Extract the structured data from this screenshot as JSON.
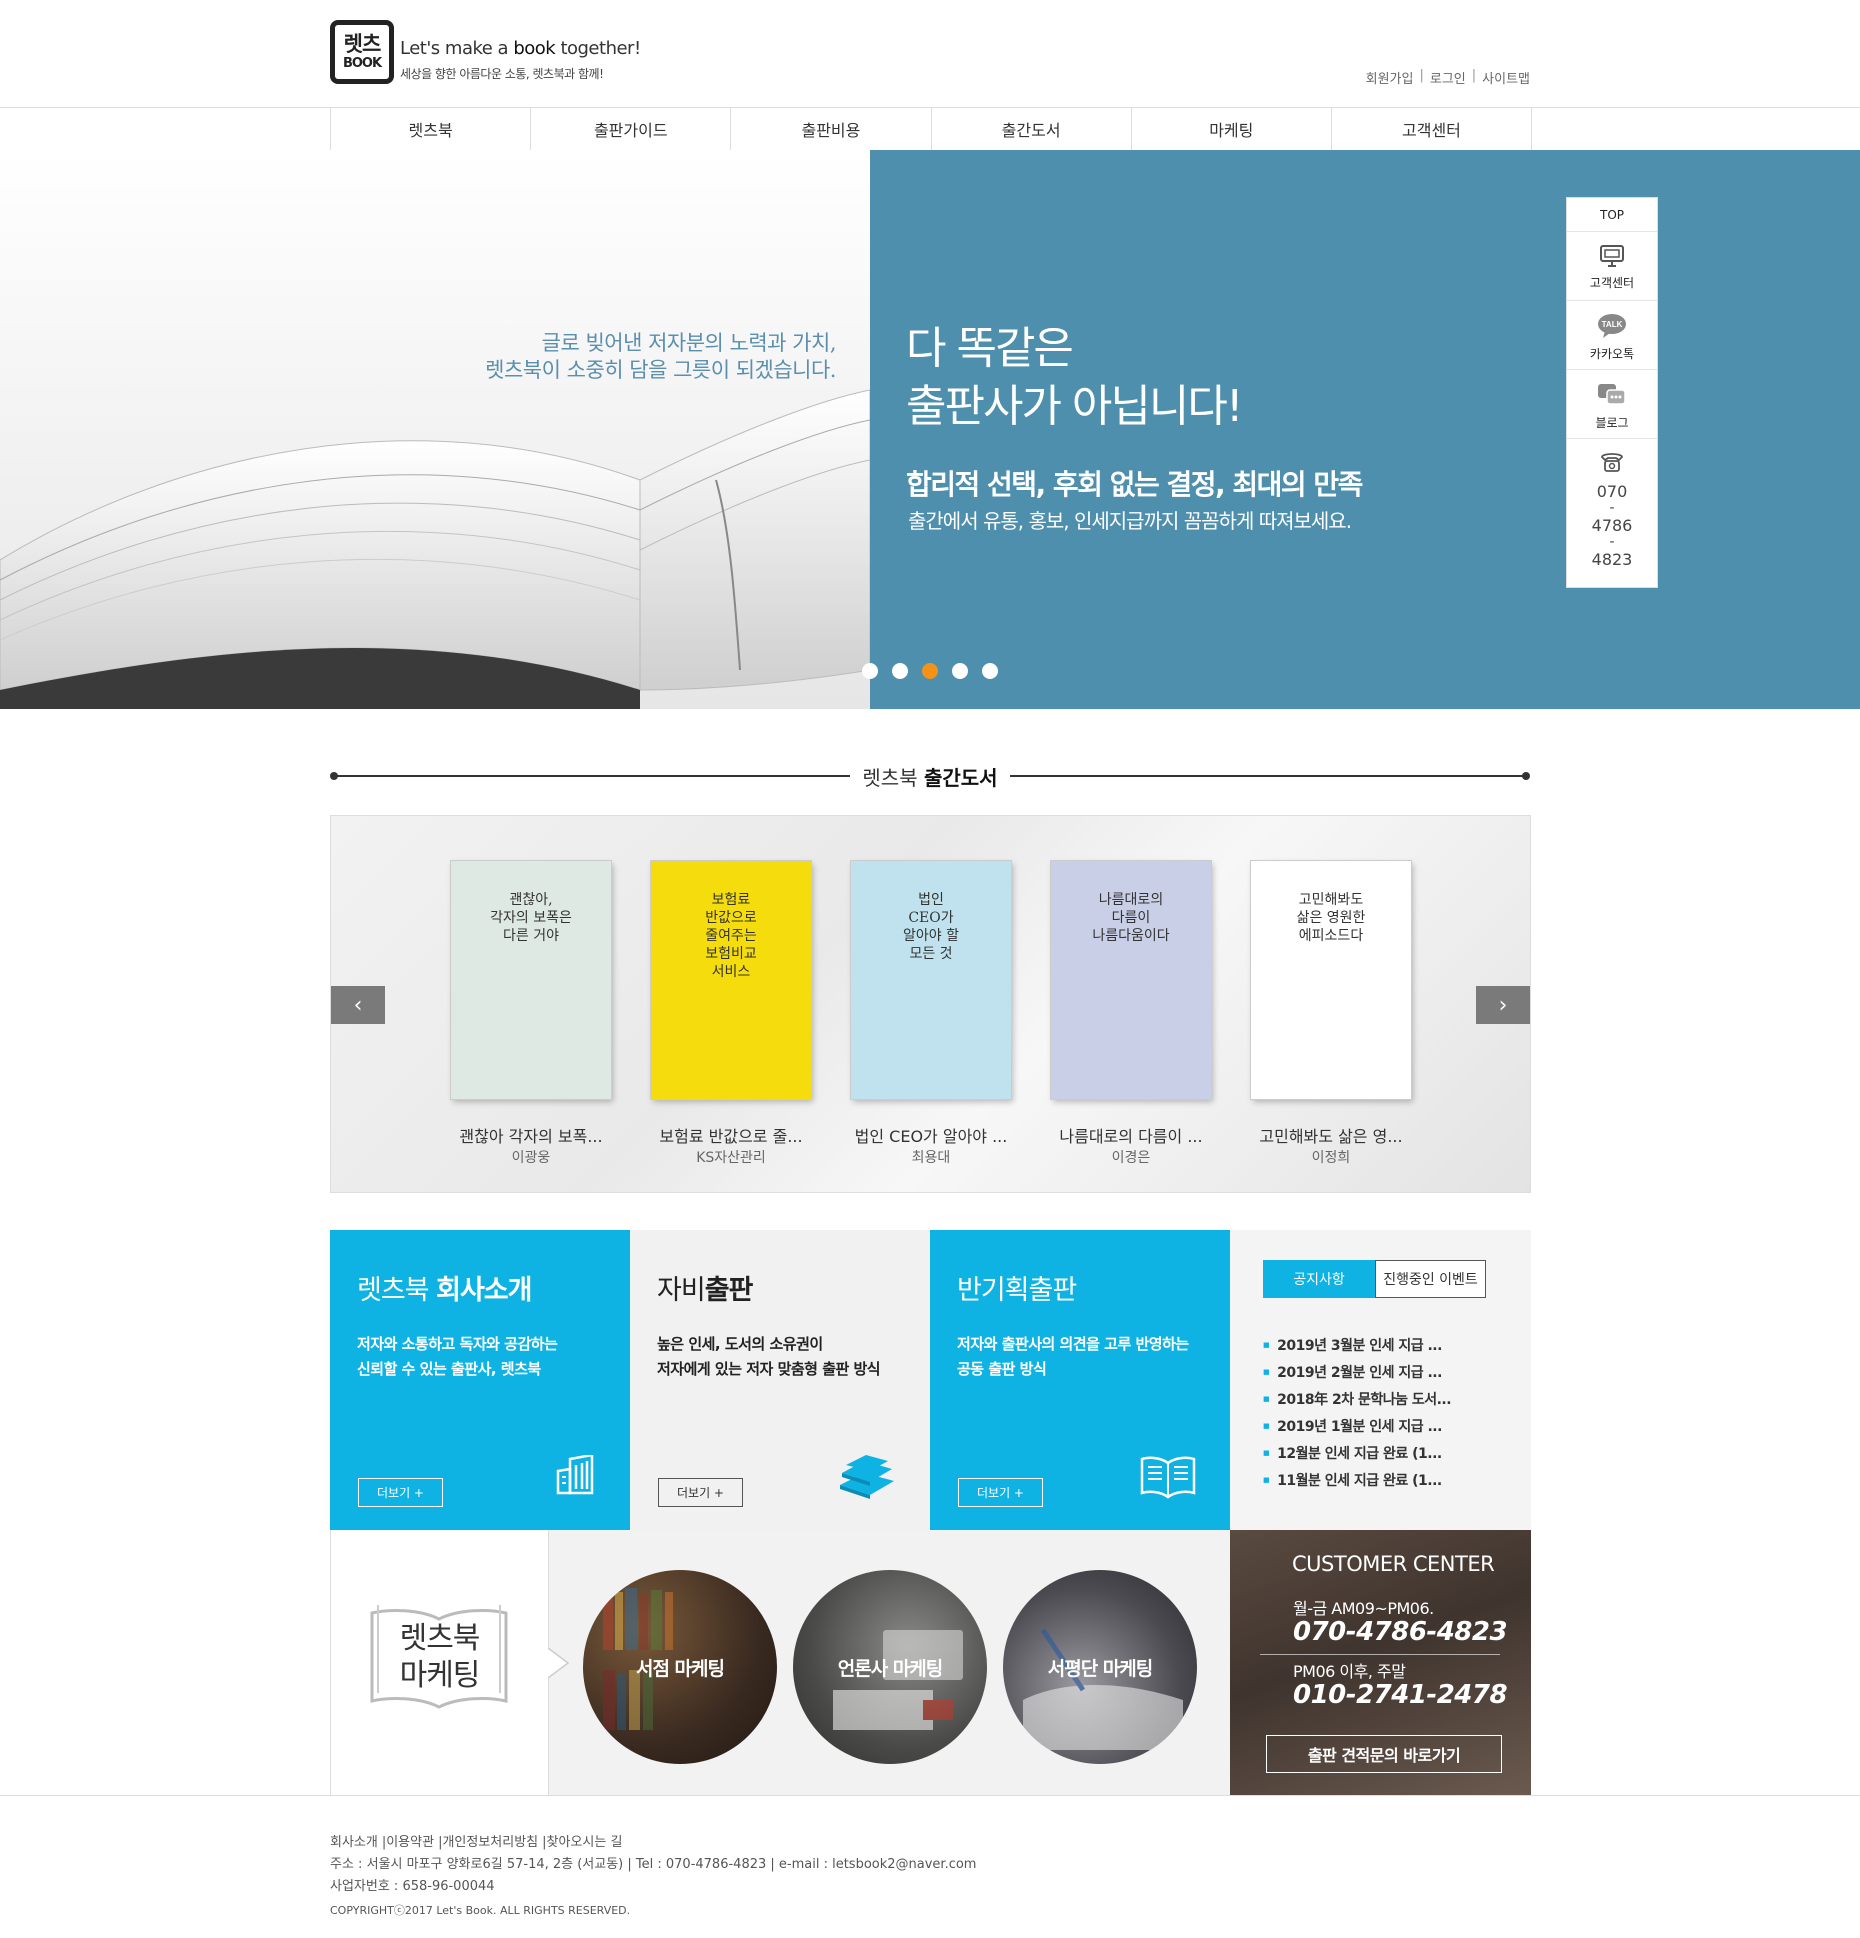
{
  "header": {
    "logo_top": "렛츠",
    "logo_bottom": "BOOK",
    "slogan_pre": "Let's",
    "slogan_make": "make a",
    "slogan_book": "book",
    "slogan_post": "together!",
    "slogan_sub": "세상을 향한 아름다운 소통, 렛츠북과 함께!",
    "util": [
      "회원가입",
      "로그인",
      "사이트맵"
    ],
    "util_sep": "|"
  },
  "nav": [
    "렛츠북",
    "출판가이드",
    "출판비용",
    "출간도서",
    "마케팅",
    "고객센터"
  ],
  "hero": {
    "quote_line1": "글로 빚어낸 저자분의 노력과 가치,",
    "quote_line2": "렛츠북이 소중히 담을 그릇이 되겠습니다.",
    "headline_line1": "다 똑같은",
    "headline_line2": "출판사가 아닙니다!",
    "subhead": "합리적 선택, 후회 없는 결정, 최대의 만족",
    "desc": "출간에서 유통, 홍보, 인세지급까지 꼼꼼하게 따져보세요.",
    "slide_count": 5,
    "active_slide": 3
  },
  "quick_menu": {
    "top": "TOP",
    "items": [
      {
        "label": "고객센터",
        "icon": "monitor-icon"
      },
      {
        "label": "카카오톡",
        "icon": "kakaotalk-icon",
        "badge": "TALK"
      },
      {
        "label": "블로그",
        "icon": "blog-chat-icon"
      }
    ],
    "phone_icon": "phone-icon",
    "phone_parts": [
      "070",
      "-",
      "4786",
      "-",
      "4823"
    ]
  },
  "books_section": {
    "title_pre": "렛츠북",
    "title_bold": "출간도서",
    "prev_icon": "chevron-left-icon",
    "next_icon": "chevron-right-icon",
    "books": [
      {
        "title": "괜찮아 각자의 보폭...",
        "author": "이광웅",
        "cover_text": "괜찮아,\n각자의 보폭은\n다른 거야",
        "cover_color": "#dfe9e4"
      },
      {
        "title": "보험료 반값으로 줄...",
        "author": "KS자산관리",
        "cover_text": "보험료\n반값으로\n줄여주는\n보험비교\n서비스",
        "cover_color": "#f5dd0d"
      },
      {
        "title": "법인 CEO가 알아야 ...",
        "author": "최용대",
        "cover_text": "법인\nCEO가\n알아야 할\n모든 것",
        "cover_color": "#bfe2ee"
      },
      {
        "title": "나름대로의 다름이 ...",
        "author": "이경은",
        "cover_text": "나름대로의\n다름이\n나름다움이다",
        "cover_color": "#c9cfe6"
      },
      {
        "title": "고민해봐도 삶은 영...",
        "author": "이정희",
        "cover_text": "고민해봐도\n삶은 영원한\n에피소드다",
        "cover_color": "#ffffff"
      }
    ]
  },
  "blocks": [
    {
      "title_pre": "렛츠북 ",
      "title_bold": "회사소개",
      "desc1": "저자와 소통하고 독자와 공감하는",
      "desc2": "신뢰할 수 있는 출판사, 렛츠북",
      "more": "더보기 +",
      "icon": "building-icon"
    },
    {
      "title_pre": "자비",
      "title_bold": "출판",
      "desc1": "높은 인세, 도서의 소유권이",
      "desc2": "저자에게 있는 저자 맞춤형 출판 방식",
      "more": "더보기 +",
      "icon": "book-stack-icon"
    },
    {
      "title_pre": "반기획출판",
      "title_bold": "",
      "desc1": "저자와 출판사의 의견을 고루 반영하는",
      "desc2": "공동 출판 방식",
      "more": "더보기 +",
      "icon": "open-book-icon"
    }
  ],
  "notice": {
    "tab_active": "공지사항",
    "tab_inactive": "진행중인 이벤트",
    "items": [
      "2019년 3월분 인세 지급 ...",
      "2019년 2월분 인세 지급 ...",
      "2018年 2차 문학나눔 도서...",
      "2019년 1월분 인세 지급 ...",
      "12월분 인세 지급 완료 (1...",
      "11월분 인세 지급 완료 (1..."
    ]
  },
  "marketing": {
    "label_line1": "렛츠북",
    "label_line2": "마케팅",
    "circles": [
      "서점 마케팅",
      "언론사 마케팅",
      "서평단 마케팅"
    ]
  },
  "customer_center": {
    "title": "CUSTOMER CENTER",
    "hours1": "월-금 AM09~PM06.",
    "phone1": "070-4786-4823",
    "hours2": "PM06 이후, 주말",
    "phone2": "010-2741-2478",
    "button": "출판 견적문의 바로가기"
  },
  "footer": {
    "links": [
      "회사소개",
      "|이용약관",
      "|개인정보처리방침",
      "|찾아오시는 길"
    ],
    "address": "주소 : 서울시 마포구 양화로6길 57-14, 2층 (서교동) | Tel : 070-4786-4823 | e-mail : letsbook2@naver.com",
    "business": "사업자번호 : 658-96-00044",
    "copyright": "COPYRIGHTⓒ2017 Let's Book. ALL RIGHTS RESERVED."
  },
  "colors": {
    "accent_blue": "#0fb3e3",
    "hero_blue": "#4f8fae",
    "active_dot": "#f39219"
  }
}
